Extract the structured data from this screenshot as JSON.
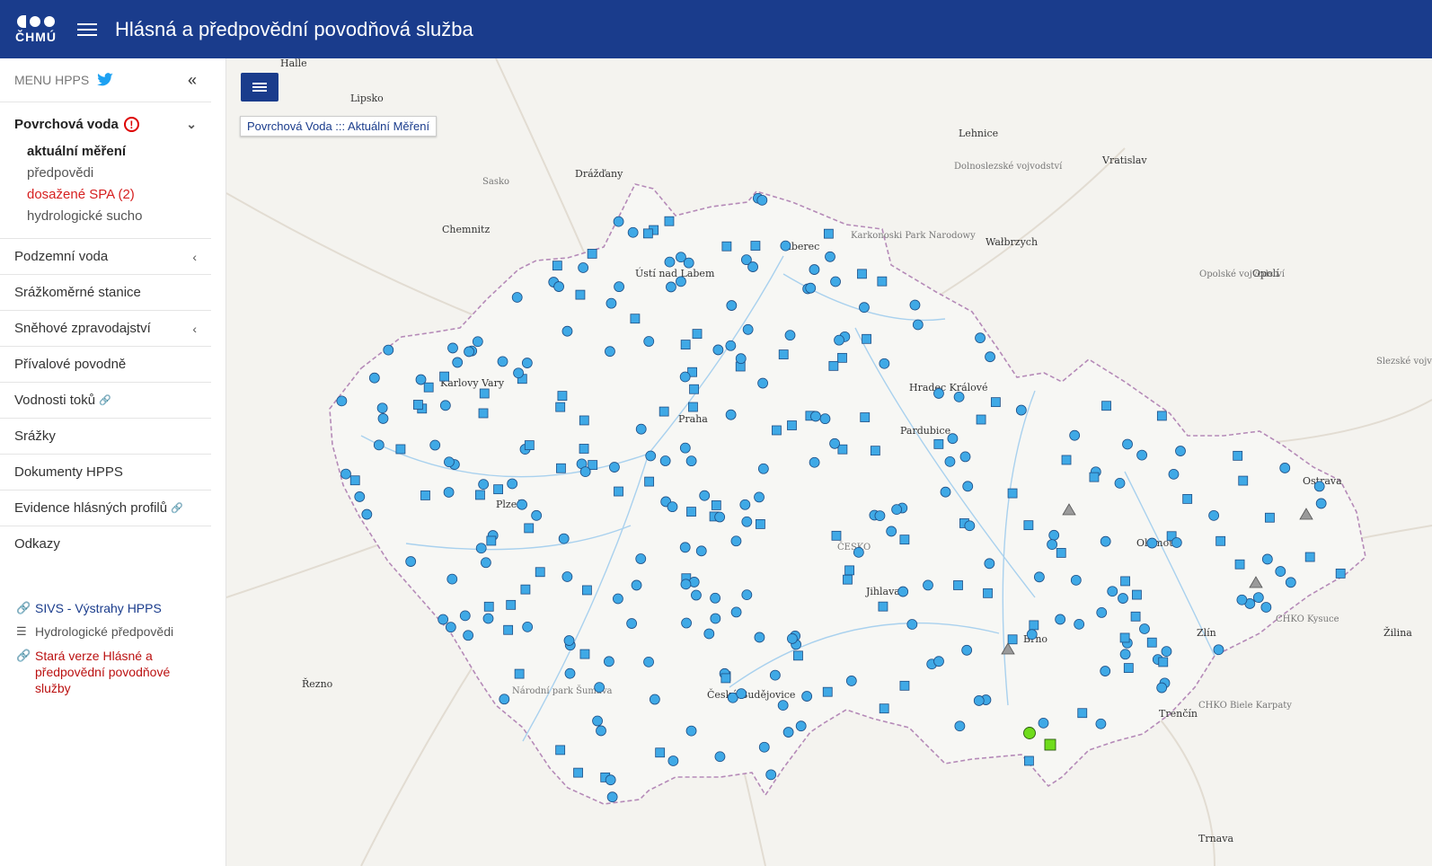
{
  "header": {
    "logo_text": "ČHMÚ",
    "title": "Hlásná a předpovědní povodňová služba"
  },
  "sidebar": {
    "menu_label": "MENU HPPS",
    "collapse_glyph": "«",
    "section_open": {
      "label": "Povrchová voda",
      "alert_glyph": "!",
      "children": [
        {
          "label": "aktuální měření"
        },
        {
          "label": "předpovědi"
        },
        {
          "label": "dosažené SPA (2)"
        },
        {
          "label": "hydrologické sucho"
        }
      ]
    },
    "items": [
      {
        "label": "Podzemní voda"
      },
      {
        "label": "Srážkoměrné stanice"
      },
      {
        "label": "Sněhové zpravodajství"
      },
      {
        "label": "Přívalové povodně"
      },
      {
        "label": "Vodnosti toků"
      },
      {
        "label": "Srážky"
      },
      {
        "label": "Dokumenty HPPS"
      },
      {
        "label": "Evidence hlásných profilů"
      },
      {
        "label": "Odkazy"
      }
    ],
    "links": [
      {
        "label": "SIVS - Výstrahy HPPS"
      },
      {
        "label": "Hydrologické předpovědi"
      },
      {
        "label": "Stará verze Hlásné a předpovědní povodňové služby"
      }
    ]
  },
  "map": {
    "layer_tooltip": "Povrchová Voda ::: Aktuální Měření",
    "colors": {
      "station": "#3fa9e6",
      "station_stroke": "#1f4f86",
      "spa": "#6fdc1b",
      "border": "#b58ab8"
    },
    "cities": [
      "Halle",
      "Lipsko",
      "Drážďany",
      "Chemnitz",
      "Karlovy Vary",
      "Plzeň",
      "Praha",
      "Ústí nad Labem",
      "Liberec",
      "Hradec Králové",
      "Pardubice",
      "Jihlava",
      "České Budějovice",
      "Brno",
      "Olomouc",
      "Ostrava",
      "Zlín",
      "Lehnice",
      "Vratislav",
      "Wałbrzych",
      "Opolí",
      "Řezno",
      "Žilina",
      "Trenčín",
      "Trnava"
    ],
    "regions": [
      "Dolnoslezské vojvodství",
      "Opolské vojvodství",
      "Sasko",
      "Karkonoski Park Narodowy",
      "Národní park Šumava",
      "CHKO Kysuce",
      "CHKO Biele Karpaty",
      "Slezské vojvodství",
      "ČESKO"
    ]
  }
}
